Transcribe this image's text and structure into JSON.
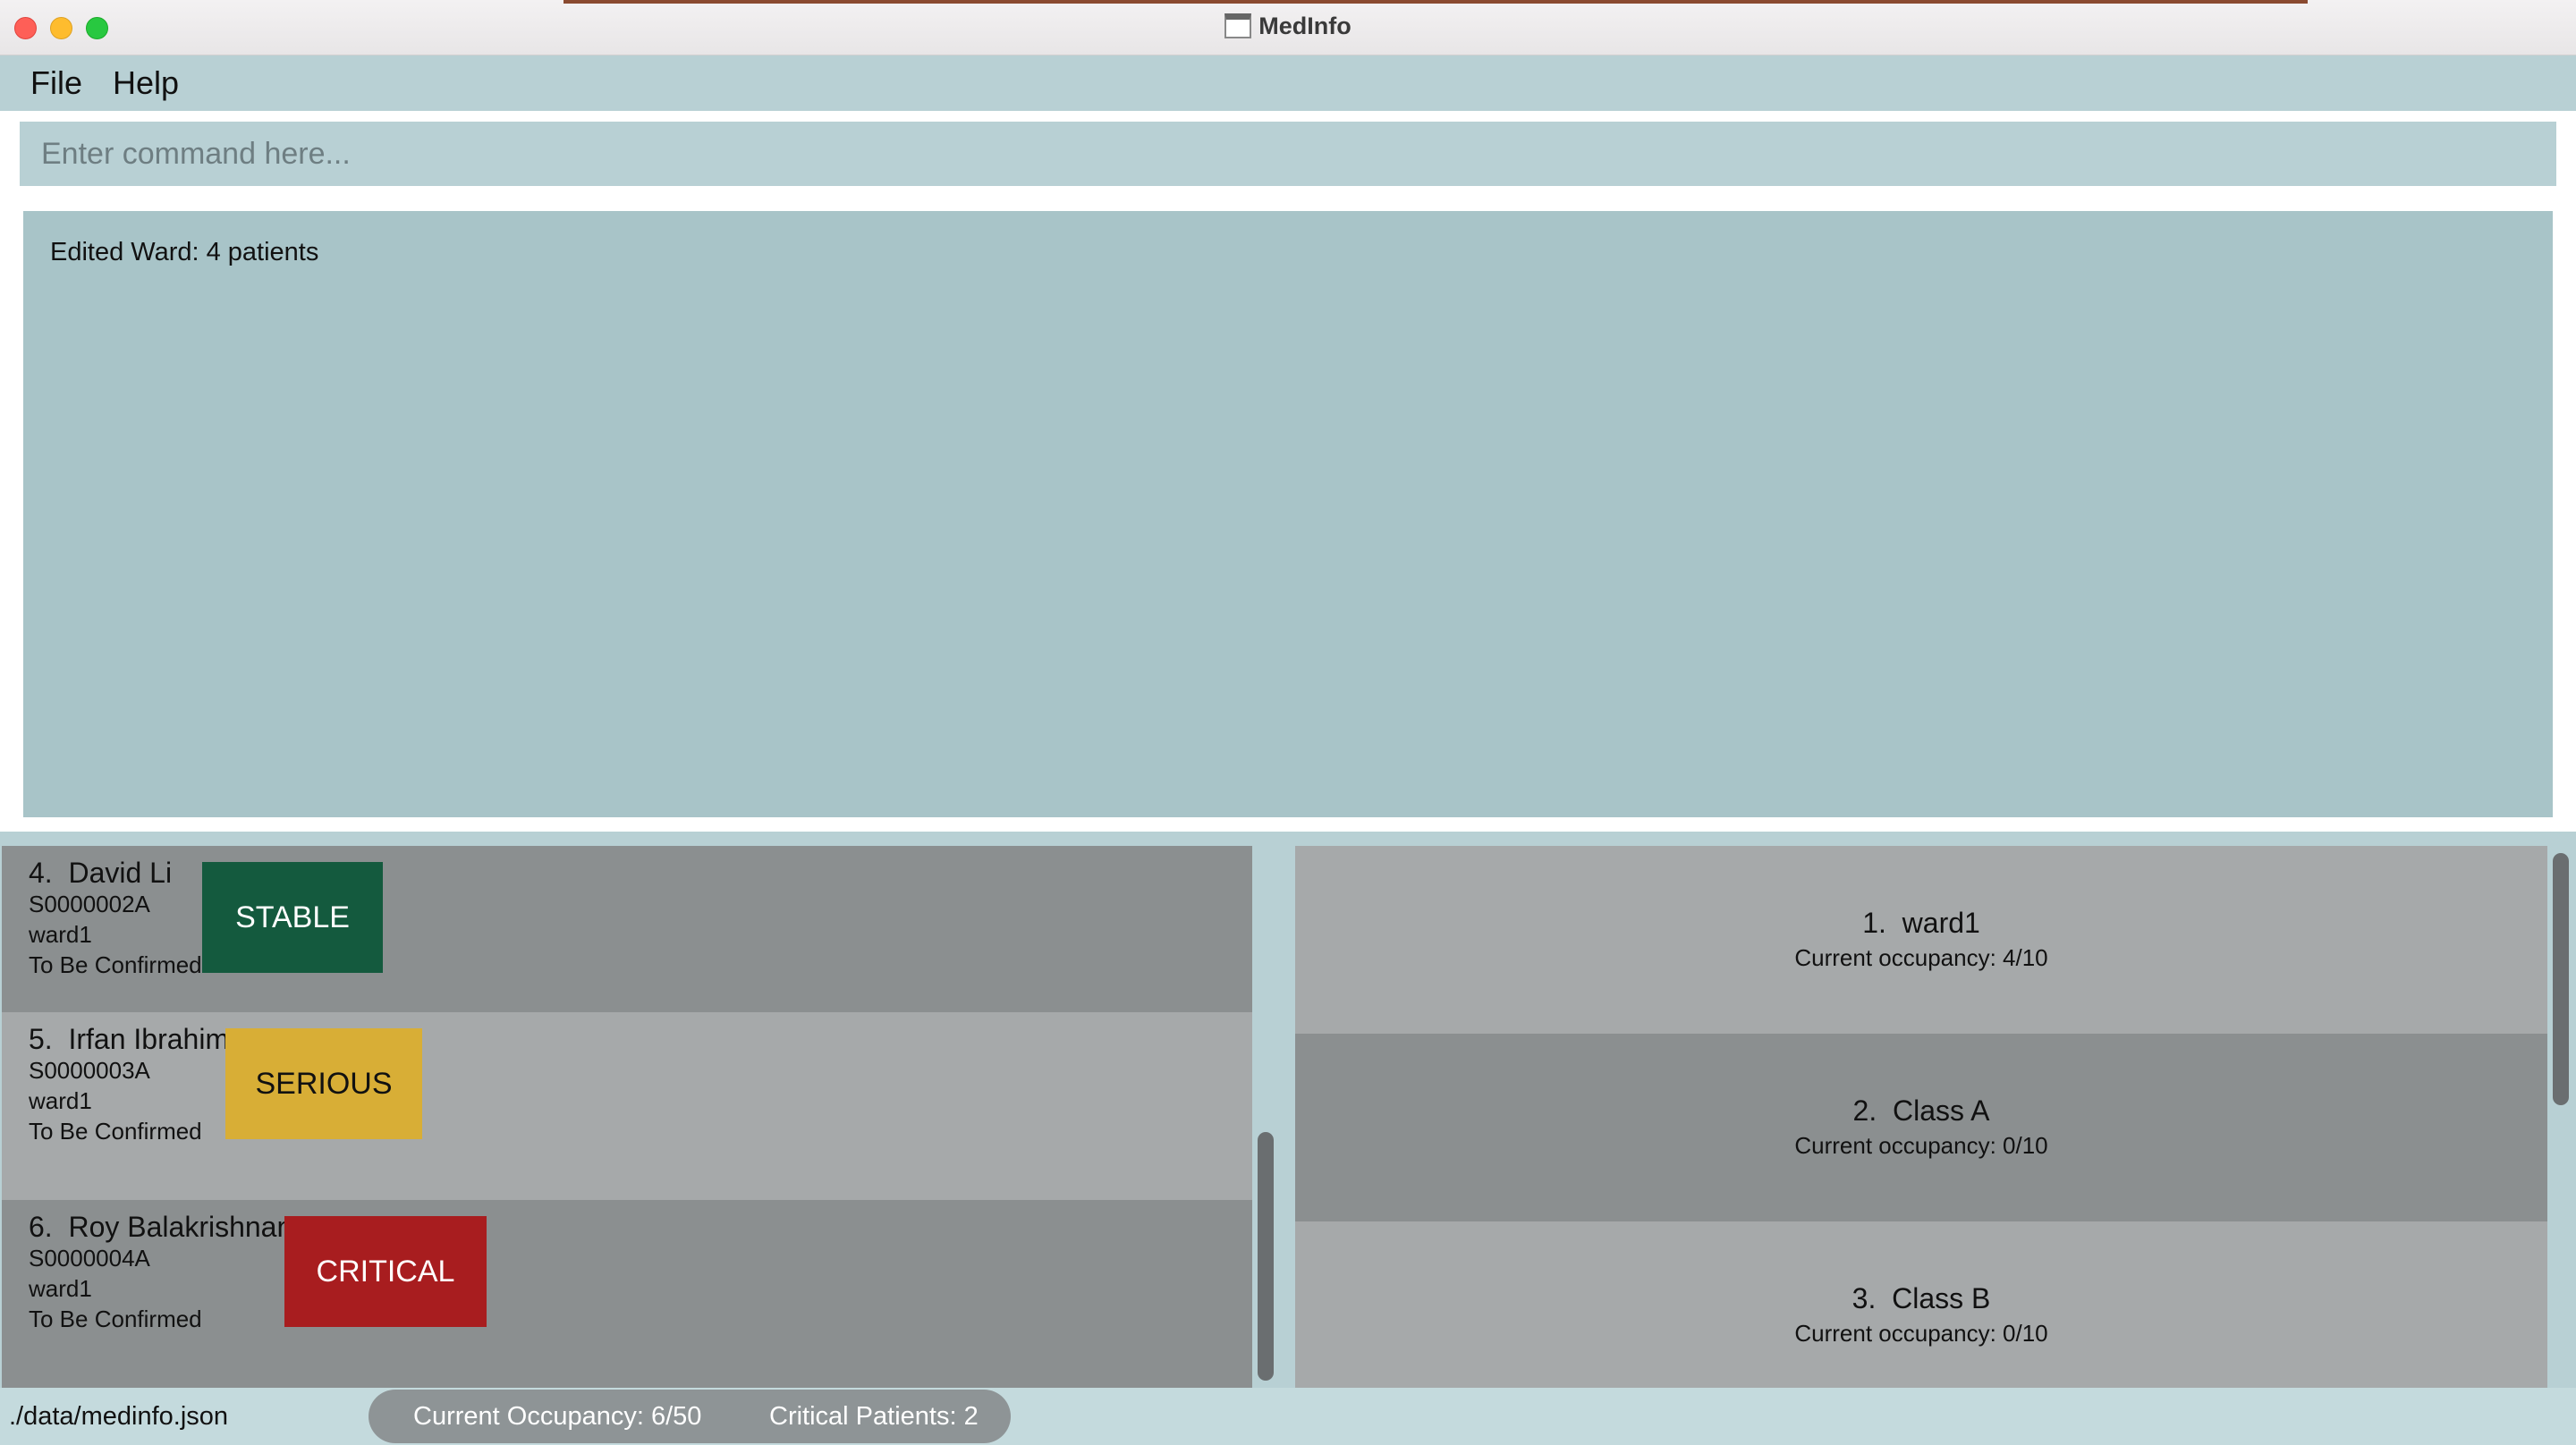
{
  "window": {
    "title": "MedInfo",
    "icon": "app-terminal-icon"
  },
  "menu": {
    "file": "File",
    "help": "Help"
  },
  "command": {
    "placeholder": "Enter command here...",
    "value": ""
  },
  "result": {
    "message": "Edited Ward: 4 patients"
  },
  "patients": [
    {
      "index": "4.",
      "name": "David Li",
      "nric": "S0000002A",
      "ward": "ward1",
      "discharge": "To Be Confirmed",
      "status": "STABLE",
      "status_color": "#145a3e"
    },
    {
      "index": "5.",
      "name": "Irfan Ibrahim",
      "nric": "S0000003A",
      "ward": "ward1",
      "discharge": "To Be Confirmed",
      "status": "SERIOUS",
      "status_color": "#d8ae36"
    },
    {
      "index": "6.",
      "name": "Roy Balakrishnan",
      "nric": "S0000004A",
      "ward": "ward1",
      "discharge": "To Be Confirmed",
      "status": "CRITICAL",
      "status_color": "#a81d1f"
    }
  ],
  "wards": [
    {
      "index": "1.",
      "name": "ward1",
      "occupancy": "Current occupancy: 4/10"
    },
    {
      "index": "2.",
      "name": "Class A",
      "occupancy": "Current occupancy: 0/10"
    },
    {
      "index": "3.",
      "name": "Class B",
      "occupancy": "Current occupancy: 0/10"
    }
  ],
  "statusbar": {
    "file_path": "./data/medinfo.json",
    "current_occupancy": "Current Occupancy: 6/50",
    "critical_patients": "Critical Patients: 2"
  }
}
